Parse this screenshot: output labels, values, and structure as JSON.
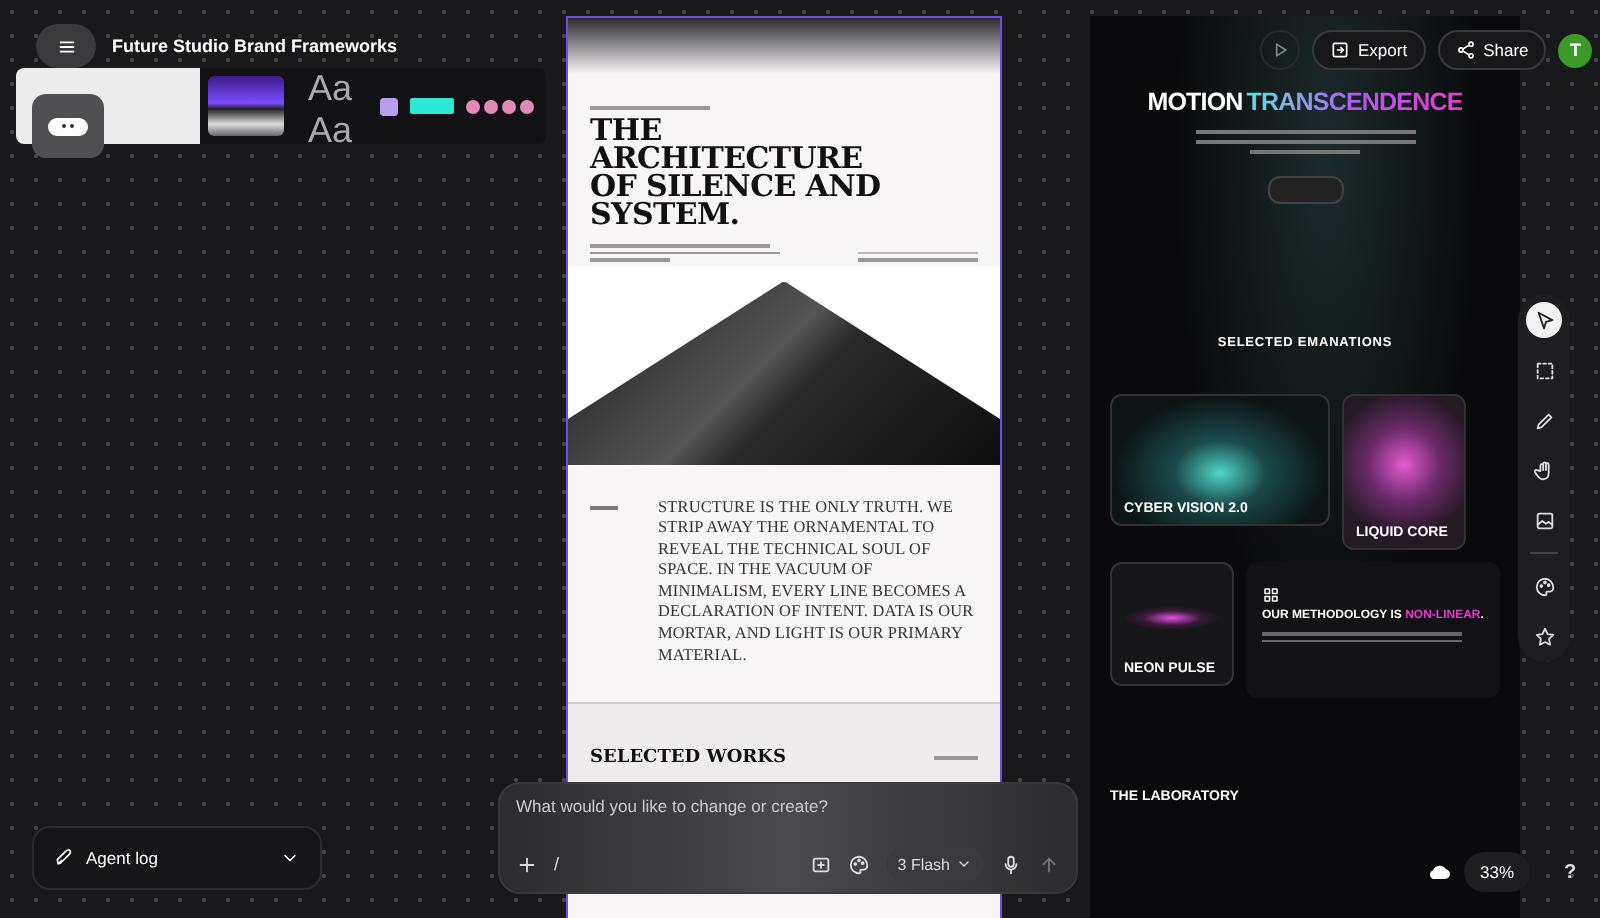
{
  "app": {
    "title": "Future Studio Brand Frameworks"
  },
  "board": {
    "type_samples": [
      "Aa",
      "Aa"
    ]
  },
  "document": {
    "title": "THE ARCHITECTURE OF SILENCE AND SYSTEM.",
    "quote": "STRUCTURE IS THE ONLY TRUTH. WE STRIP AWAY THE ORNAMENTAL TO REVEAL THE TECHNICAL SOUL OF SPACE. IN THE VACUUM OF MINIMALISM, EVERY LINE BECOMES A DECLARATION OF INTENT. DATA IS OUR MORTAR, AND LIGHT IS OUR PRIMARY MATERIAL.",
    "section_title": "SELECTED WORKS"
  },
  "header_actions": [
    {
      "kind": "play"
    },
    {
      "kind": "export",
      "label": "Export"
    },
    {
      "kind": "share",
      "label": "Share"
    }
  ],
  "avatar": "T",
  "preview": {
    "headline_lead": "MOTION",
    "headline_accent": "TRANSCENDENCE",
    "section_title": "SELECTED EMANATIONS",
    "cards": [
      {
        "kind": "cyber",
        "title": "CYBER VISION 2.0"
      },
      {
        "kind": "liquid",
        "title": "LIQUID CORE"
      },
      {
        "kind": "pulse",
        "title": "NEON PULSE"
      }
    ],
    "methodology_lead": "OUR METHODOLOGY IS",
    "methodology_accent": "NON-LINEAR",
    "methodology_end": ".",
    "lab_title": "THE LABORATORY"
  },
  "tools": [
    {
      "kind": "pointer",
      "selected": true
    },
    {
      "kind": "marquee",
      "selected": false
    },
    {
      "kind": "pen",
      "selected": false
    },
    {
      "kind": "hand",
      "selected": false
    },
    {
      "kind": "image",
      "selected": false
    },
    {
      "kind": "palette",
      "selected": false
    },
    {
      "kind": "star",
      "selected": false
    }
  ],
  "agent_log": {
    "label": "Agent log"
  },
  "prompt": {
    "placeholder": "What would you like to change or create?",
    "slash": "/",
    "model": "3 Flash"
  },
  "zoom": {
    "value": "33%",
    "help": "?"
  }
}
